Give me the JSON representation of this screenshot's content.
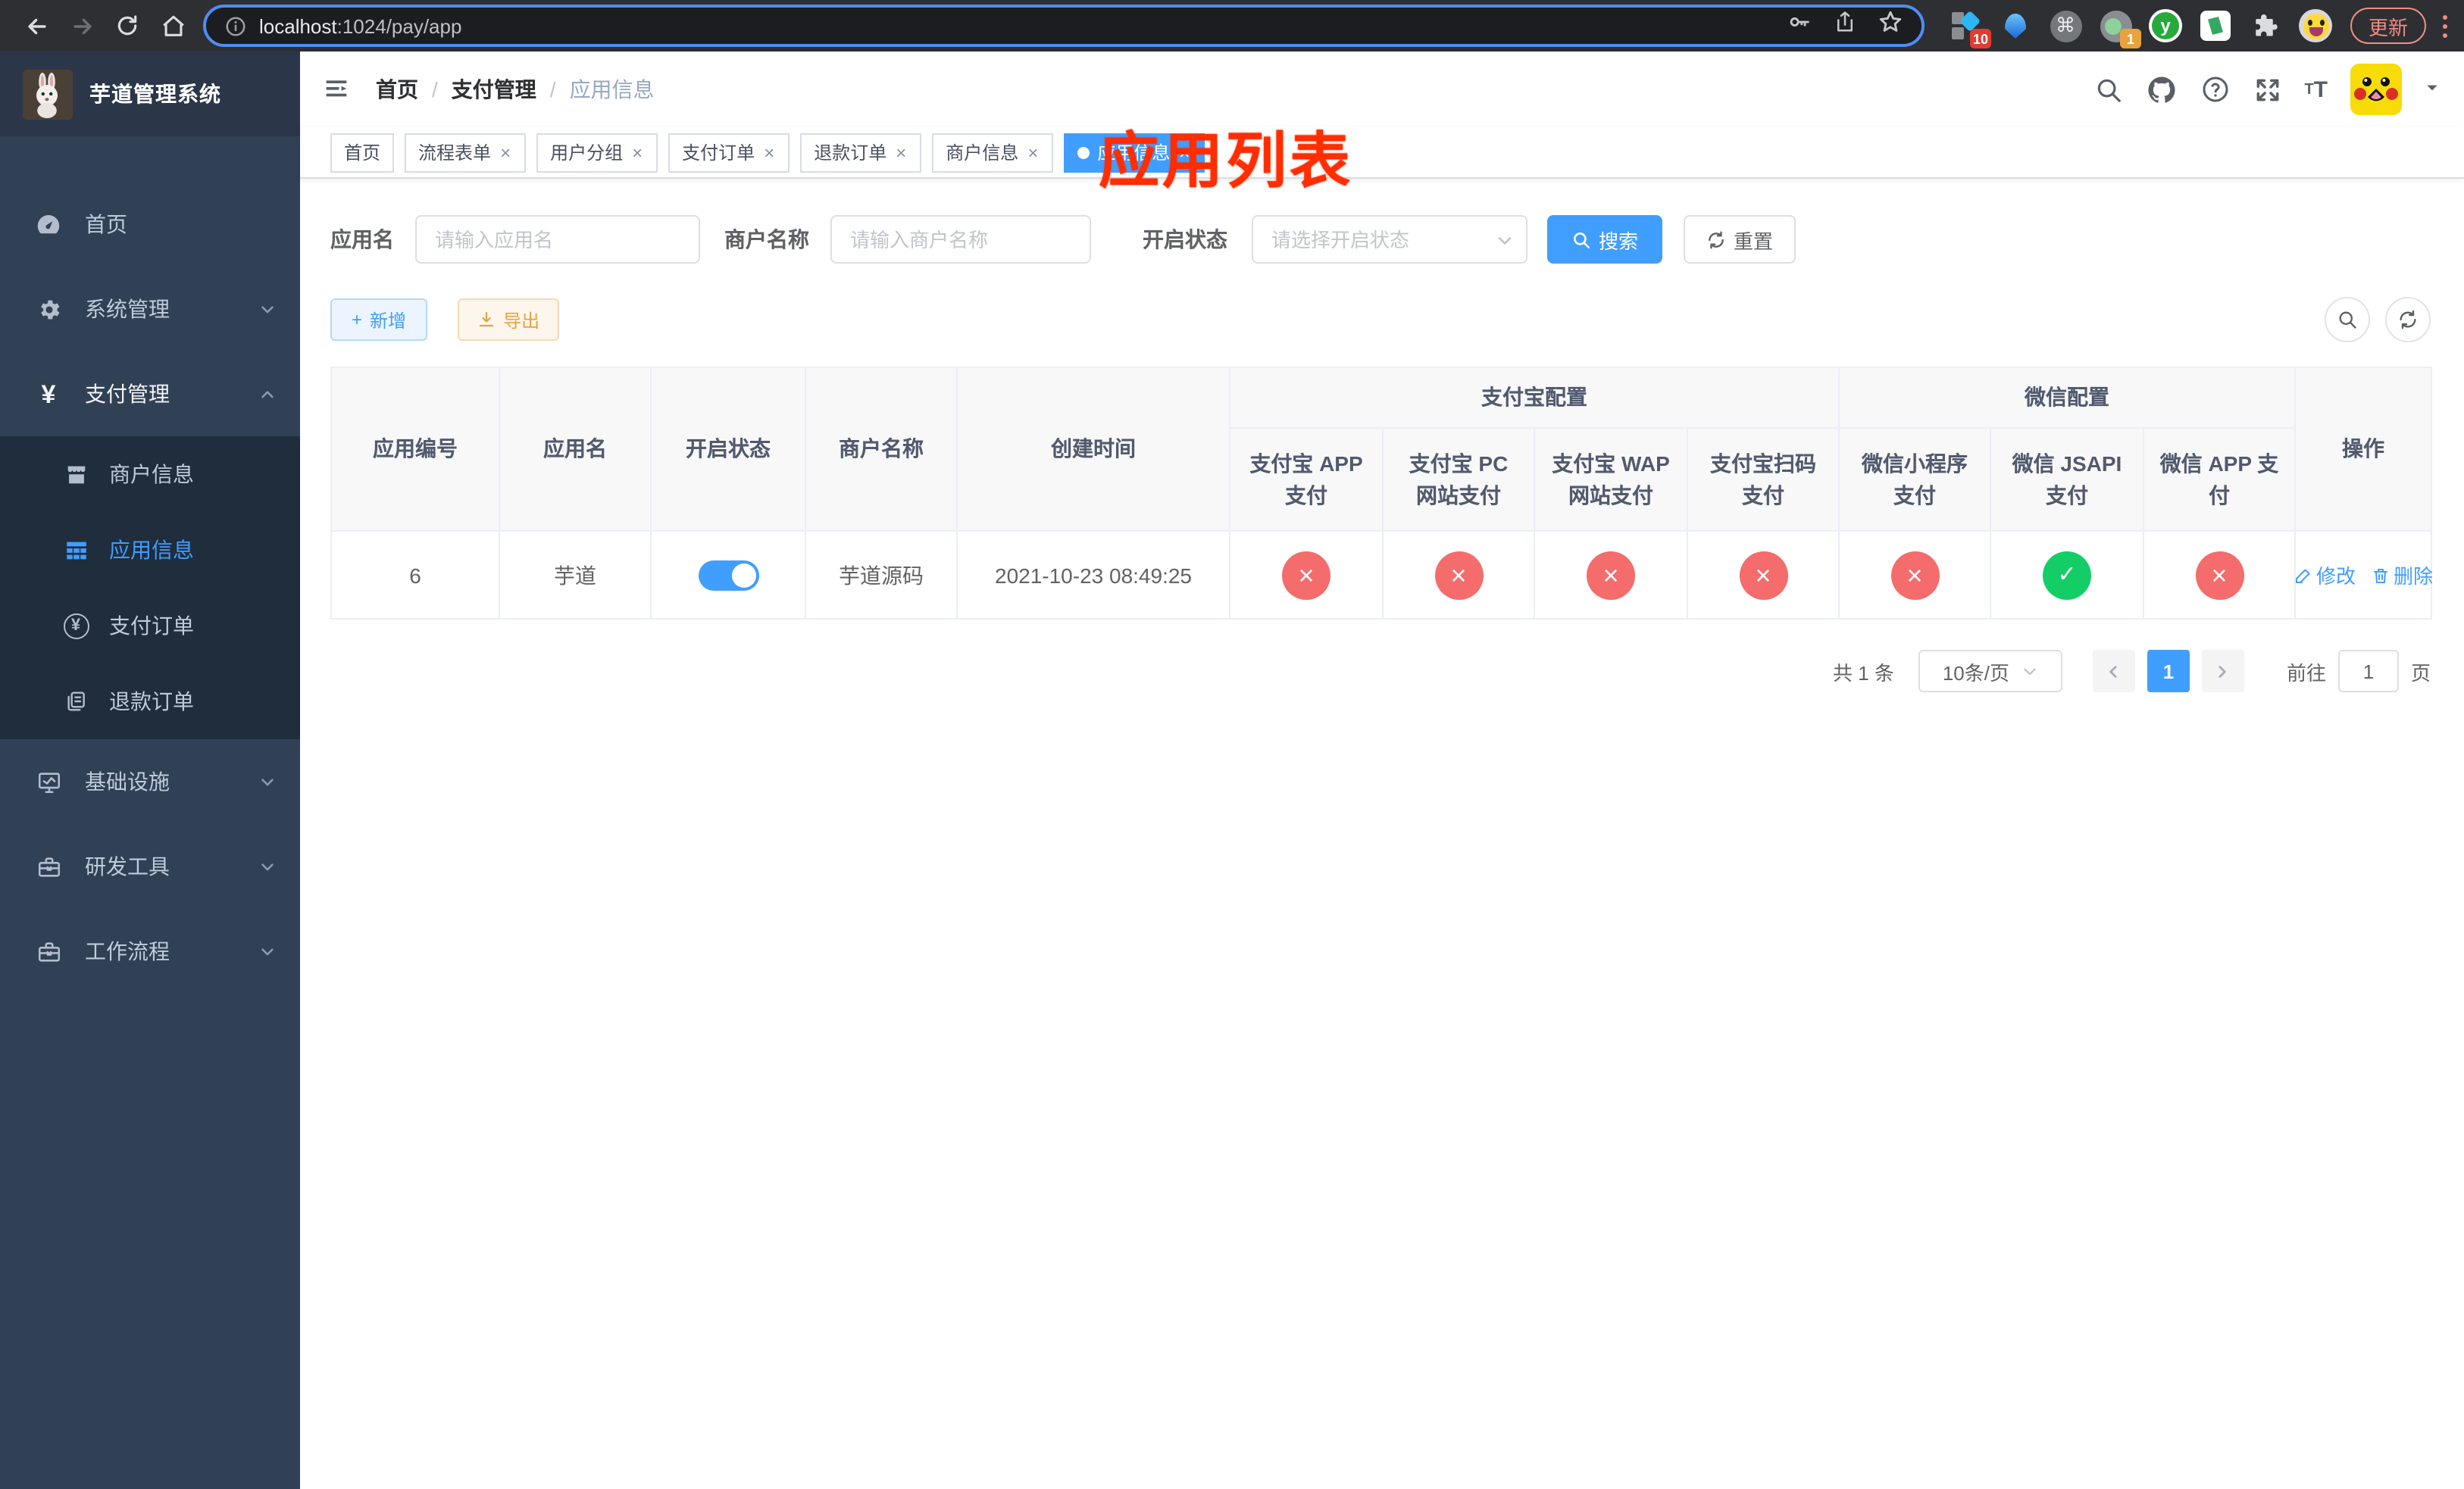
{
  "colors": {
    "primary": "#409eff",
    "danger": "#f56c6c",
    "success": "#13ce66",
    "warning": "#e6a23c",
    "annotation_red": "#ff2d00",
    "sidebar_bg": "#304156",
    "submenu_bg": "#1f2d3d"
  },
  "icons": {
    "close": "×",
    "check": "✓",
    "cross": "×",
    "plus": "+",
    "yen": "¥",
    "command": "⌘",
    "y_letter": "y"
  },
  "browser": {
    "url_host": "localhost",
    "url_rest": ":1024/pay/app",
    "update_label": "更新",
    "ext_badge_collector": "10",
    "ext_badge_stats": "1"
  },
  "sidebar": {
    "logo_title": "芋道管理系统",
    "menu": [
      {
        "label": "首页"
      },
      {
        "label": "系统管理"
      },
      {
        "label": "支付管理"
      },
      {
        "label": "基础设施"
      },
      {
        "label": "研发工具"
      },
      {
        "label": "工作流程"
      }
    ],
    "submenu": [
      {
        "label": "商户信息"
      },
      {
        "label": "应用信息"
      },
      {
        "label": "支付订单"
      },
      {
        "label": "退款订单"
      }
    ]
  },
  "navbar": {
    "breadcrumb": {
      "home": "首页",
      "sep": "/",
      "section": "支付管理",
      "current": "应用信息"
    }
  },
  "annotation": {
    "title": "应用列表"
  },
  "tags": [
    {
      "label": "首页"
    },
    {
      "label": "流程表单"
    },
    {
      "label": "用户分组"
    },
    {
      "label": "支付订单"
    },
    {
      "label": "退款订单"
    },
    {
      "label": "商户信息"
    },
    {
      "label": "应用信息"
    }
  ],
  "filters": {
    "app_name_label": "应用名",
    "app_name_placeholder": "请输入应用名",
    "merchant_label": "商户名称",
    "merchant_placeholder": "请输入商户名称",
    "status_label": "开启状态",
    "status_placeholder": "请选择开启状态",
    "search_label": "搜索",
    "reset_label": "重置"
  },
  "toolbar": {
    "add_label": "新增",
    "export_label": "导出"
  },
  "table": {
    "headers": {
      "app_id": "应用编号",
      "app_name": "应用名",
      "status": "开启状态",
      "merchant": "商户名称",
      "create_time": "创建时间",
      "alipay_group": "支付宝配置",
      "wechat_group": "微信配置",
      "alipay_app": "支付宝 APP 支付",
      "alipay_pc": "支付宝 PC 网站支付",
      "alipay_wap": "支付宝 WAP 网站支付",
      "alipay_qr": "支付宝扫码支付",
      "wx_lite": "微信小程序支付",
      "wx_jsapi": "微信 JSAPI 支付",
      "wx_app": "微信 APP 支付",
      "actions": "操作"
    },
    "row": {
      "app_id": "6",
      "app_name": "芋道",
      "enabled": true,
      "merchant": "芋道源码",
      "create_time": "2021-10-23 08:49:25",
      "statuses": [
        "no",
        "no",
        "no",
        "no",
        "no",
        "yes",
        "no"
      ],
      "edit_label": "修改",
      "delete_label": "删除"
    }
  },
  "pagination": {
    "total_text": "共 1 条",
    "page_size": "10条/页",
    "current_page": "1",
    "goto_label": "前往",
    "goto_value": "1",
    "page_label": "页"
  }
}
